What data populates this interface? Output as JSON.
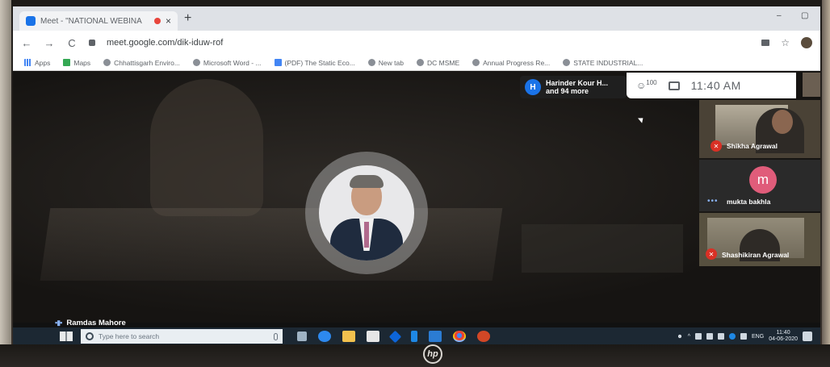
{
  "browser": {
    "tab_title": "Meet - \"NATIONAL WEBINA",
    "tab_close": "×",
    "new_tab": "+",
    "window_minimize": "–",
    "window_restore": "▢",
    "back": "←",
    "forward": "→",
    "reload": "C",
    "url": "meet.google.com/dik-iduw-rof",
    "bookmarks": [
      {
        "label": "Apps",
        "icon": "apps-grid-icon"
      },
      {
        "label": "Maps",
        "icon": "maps-icon"
      },
      {
        "label": "Chhattisgarh Enviro...",
        "icon": "globe-icon"
      },
      {
        "label": "Microsoft Word - ...",
        "icon": "globe-icon"
      },
      {
        "label": "(PDF) The Static Eco...",
        "icon": "pdf-icon"
      },
      {
        "label": "New tab",
        "icon": "globe-icon"
      },
      {
        "label": "DC MSME",
        "icon": "globe-icon"
      },
      {
        "label": "Annual Progress Re...",
        "icon": "globe-icon"
      },
      {
        "label": "STATE INDUSTRIAL...",
        "icon": "globe-icon"
      }
    ]
  },
  "meet": {
    "participants_chip": {
      "avatar_letter": "H",
      "line1": "Harinder Kour H...",
      "line2": "and 94 more"
    },
    "people_count": "100",
    "clock": "11:40 AM",
    "tiles": [
      {
        "name": "Shikha Agrawal",
        "muted": true
      },
      {
        "name": "mukta bakhla",
        "avatar_letter": "m",
        "muted": false
      },
      {
        "name": "Shashikiran Agrawal",
        "muted": true
      }
    ],
    "speaker_name": "Ramdas Mahore",
    "colors": {
      "accent": "#1a73e8",
      "muted": "#d93025",
      "avatar_m": "#e05c7a"
    }
  },
  "taskbar": {
    "search_placeholder": "Type here to search",
    "tray_language": "ENG",
    "time": "11:40",
    "date": "04-06-2020"
  },
  "device": {
    "logo": "hp"
  }
}
